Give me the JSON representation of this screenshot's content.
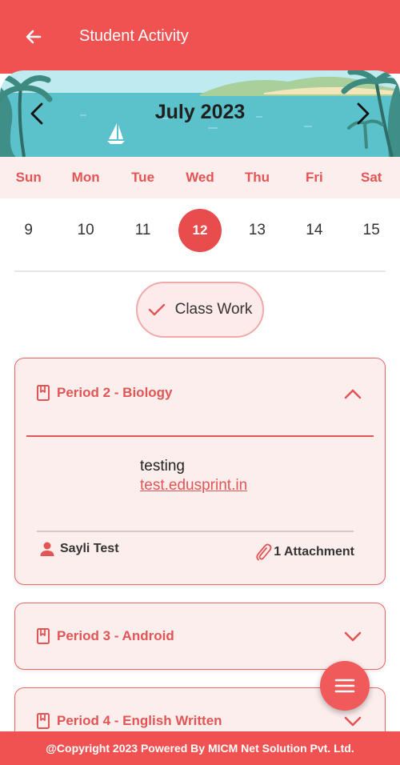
{
  "appbar": {
    "title": "Student Activity"
  },
  "calendar": {
    "month_title": "July 2023",
    "weekdays": [
      "Sun",
      "Mon",
      "Tue",
      "Wed",
      "Thu",
      "Fri",
      "Sat"
    ],
    "days": [
      "9",
      "10",
      "11",
      "12",
      "13",
      "14",
      "15"
    ],
    "selected_day": "12"
  },
  "filter_chip": {
    "label": "Class Work",
    "selected": true
  },
  "periods": [
    {
      "title": "Period 2 - Biology",
      "expanded": true,
      "description": "testing",
      "link": "test.edusprint.in",
      "author": "Sayli Test",
      "attachment": "1 Attachment"
    },
    {
      "title": "Period 3 - Android",
      "expanded": false
    },
    {
      "title": "Period 4 - English Written",
      "expanded": false
    }
  ],
  "footer": {
    "text": "@Copyright 2023 Powered By MICM Net Solution Pvt. Ltd."
  },
  "colors": {
    "primary": "#f05252",
    "accent_text": "#e25555",
    "card_bg": "#fdeeee"
  },
  "icons": [
    "back-arrow-icon",
    "chevron-left-icon",
    "chevron-right-icon",
    "check-icon",
    "book-icon",
    "chevron-up-icon",
    "chevron-down-icon",
    "person-icon",
    "paperclip-icon",
    "menu-icon"
  ]
}
